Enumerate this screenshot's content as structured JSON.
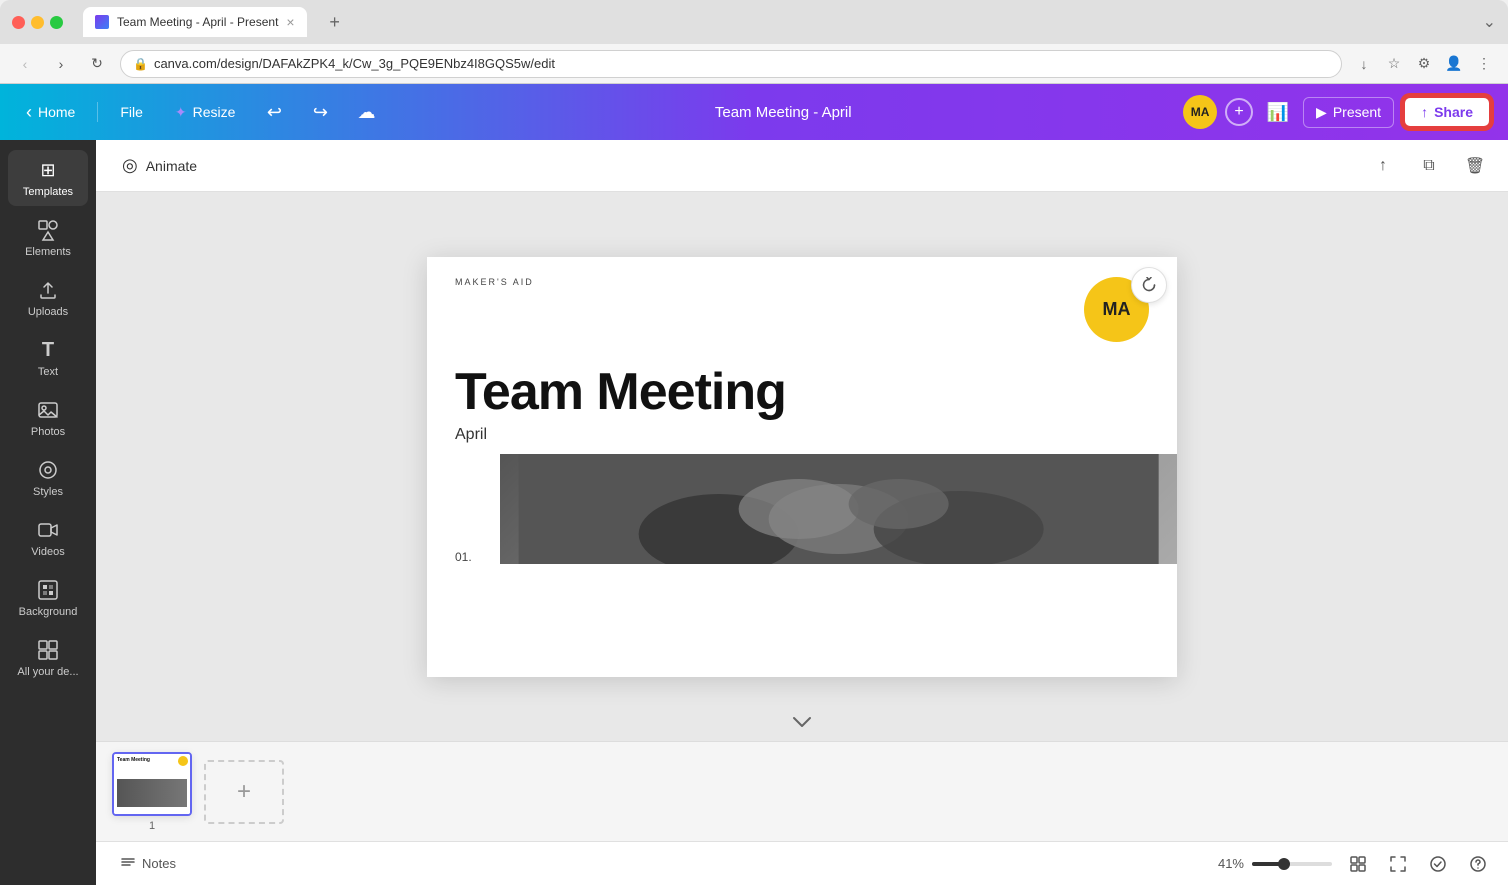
{
  "browser": {
    "tab_title": "Team Meeting - April - Present",
    "tab_close": "×",
    "tab_new": "+",
    "collapse_icon": "⌄",
    "address_url": "canva.com/design/DAFAkZPK4_k/Cw_3g_PQE9ENbz4I8GQS5w/edit",
    "nav_back": "‹",
    "nav_forward": "›",
    "nav_refresh": "↻"
  },
  "header": {
    "back_icon": "‹",
    "home_label": "Home",
    "file_label": "File",
    "resize_label": "Resize",
    "resize_icon": "✦",
    "undo_icon": "↩",
    "redo_icon": "↪",
    "cloud_icon": "☁",
    "title": "Team Meeting - April",
    "avatar_text": "MA",
    "add_icon": "+",
    "chart_icon": "📊",
    "present_icon": "▶",
    "present_label": "Present",
    "share_icon": "↑",
    "share_label": "Share"
  },
  "sidebar": {
    "items": [
      {
        "id": "templates",
        "label": "Templates",
        "icon": "⊞"
      },
      {
        "id": "elements",
        "label": "Elements",
        "icon": "◇"
      },
      {
        "id": "uploads",
        "label": "Uploads",
        "icon": "↑"
      },
      {
        "id": "text",
        "label": "Text",
        "icon": "T"
      },
      {
        "id": "photos",
        "label": "Photos",
        "icon": "🖼"
      },
      {
        "id": "styles",
        "label": "Styles",
        "icon": "◎"
      },
      {
        "id": "videos",
        "label": "Videos",
        "icon": "▶"
      },
      {
        "id": "background",
        "label": "Background",
        "icon": "▦"
      },
      {
        "id": "all-designs",
        "label": "All your de...",
        "icon": "⊟"
      }
    ]
  },
  "toolbar": {
    "animate_icon": "◎",
    "animate_label": "Animate",
    "share_icon": "↑",
    "copy_icon": "⧉",
    "delete_icon": "🗑"
  },
  "slide": {
    "maker_label": "MAKER'S AID",
    "avatar_text": "MA",
    "title": "Team Meeting",
    "subtitle": "April",
    "number": "01."
  },
  "filmstrip": {
    "slide1_title": "Team Meeting",
    "slide1_number": "1",
    "add_label": "+"
  },
  "bottom_bar": {
    "notes_icon": "≡",
    "notes_label": "Notes",
    "zoom_percent": "41%",
    "grid_icon": "⊞",
    "fullscreen_icon": "⤢",
    "check_icon": "✓",
    "help_icon": "?"
  },
  "colors": {
    "header_gradient_start": "#00b4db",
    "header_gradient_end": "#9333ea",
    "accent_purple": "#7c3aed",
    "share_highlight": "#e53e3e",
    "avatar_yellow": "#f5c518",
    "sidebar_bg": "#2d2d2d"
  }
}
